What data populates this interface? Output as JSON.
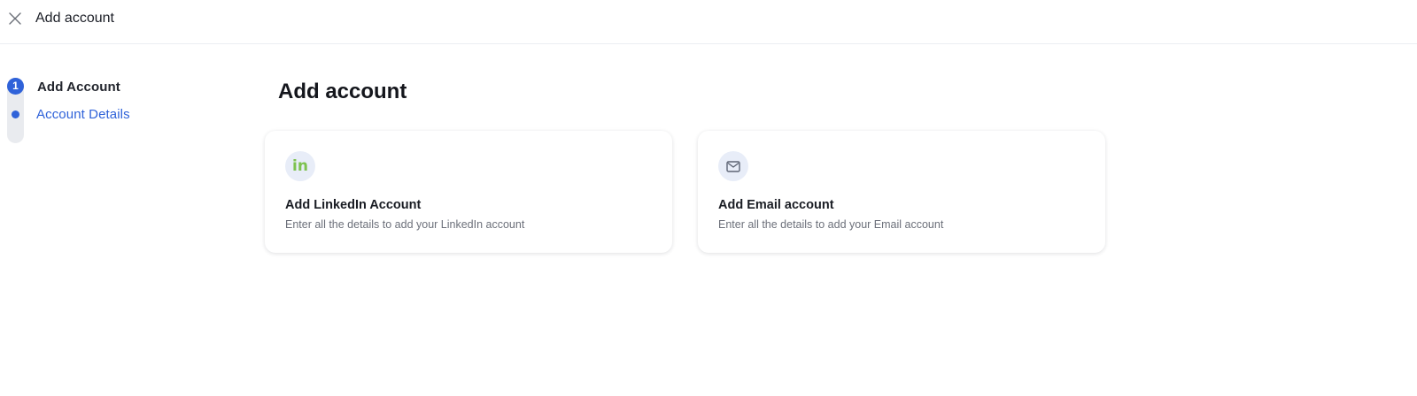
{
  "header": {
    "title": "Add account",
    "close_icon": "close-icon"
  },
  "stepper": {
    "steps": [
      {
        "number": "1",
        "label": "Add Account",
        "state": "completed"
      },
      {
        "label": "Account Details",
        "state": "active"
      }
    ],
    "active_color": "#2f62d9"
  },
  "main": {
    "title": "Add account",
    "cards": [
      {
        "icon": "linkedin-icon",
        "icon_text": "in",
        "icon_color": "#7dc24f",
        "title": "Add LinkedIn Account",
        "description": "Enter all the details to add your LinkedIn account"
      },
      {
        "icon": "mail-icon",
        "icon_color": "#5d6474",
        "title": "Add Email account",
        "description": "Enter all the details to add your Email account"
      }
    ]
  }
}
